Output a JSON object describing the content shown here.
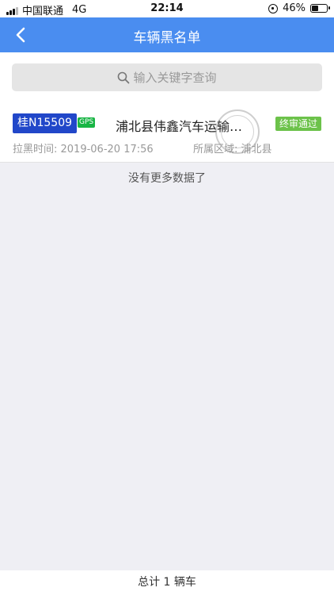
{
  "status_bar": {
    "carrier": "中国联通",
    "network": "4G",
    "time": "22:14",
    "battery": "46%",
    "battery_level": 0.46
  },
  "navbar": {
    "title": "车辆黑名单",
    "back_icon": "chevron-left-icon"
  },
  "search": {
    "placeholder": "输入关键字查询",
    "icon": "search-icon"
  },
  "list": {
    "items": [
      {
        "plate": "桂N15509",
        "gps": "GPS",
        "company": "浦北县伟鑫汽车运输有限公司",
        "status": "终审通过",
        "blacklist_time_label": "拉黑时间: ",
        "blacklist_time": "2019-06-20 17:56",
        "region_label": "所属区域: ",
        "region": "浦北县"
      }
    ]
  },
  "no_more": "没有更多数据了",
  "footer": {
    "total": "总计 1 辆车"
  },
  "colors": {
    "nav": "#4a8df0",
    "plate": "#2147c9",
    "gps": "#19b545",
    "status": "#6cc24a"
  }
}
